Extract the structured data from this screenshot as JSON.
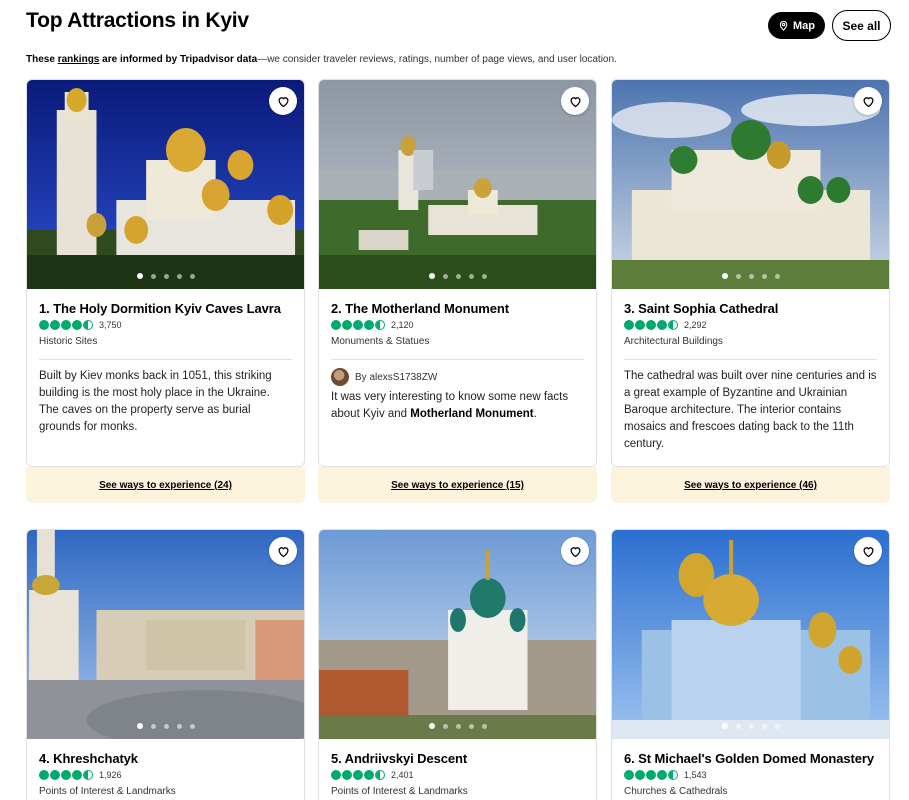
{
  "header": {
    "title": "Top Attractions in Kyiv",
    "map_label": "Map",
    "see_all_label": "See all"
  },
  "disclaimer": {
    "prefix": "These ",
    "link": "rankings",
    "middle": " are informed by Tripadvisor data",
    "suffix": "—we consider traveler reviews, ratings, number of page views, and user location."
  },
  "colors": {
    "rating_green": "#00aa6c",
    "experience_bg": "#fcf3dd"
  },
  "cards": [
    {
      "title": "1. The Holy Dormition Kyiv Caves Lavra",
      "rating": 4.5,
      "review_count": "3,750",
      "category": "Historic Sites",
      "description": "Built by Kiev monks back in 1051, this striking building is the most holy place in the Ukraine. The caves on the property serve as burial grounds for monks.",
      "experience_label": "See ways to experience (24)"
    },
    {
      "title": "2. The Motherland Monument",
      "rating": 4.5,
      "review_count": "2,120",
      "category": "Monuments & Statues",
      "review_author": "By alexsS1738ZW",
      "review_text_a": "It was very interesting to know some new facts about Kyiv and ",
      "review_text_bold": "Motherland Monument",
      "review_text_b": ".",
      "experience_label": "See ways to experience (15)"
    },
    {
      "title": "3. Saint Sophia Cathedral",
      "rating": 4.5,
      "review_count": "2,292",
      "category": "Architectural Buildings",
      "description": "The cathedral was built over nine centuries and is a great example of Byzantine and Ukrainian Baroque architecture. The interior contains mosaics and frescoes dating back to the 11th century.",
      "experience_label": "See ways to experience (46)"
    },
    {
      "title": "4. Khreshchatyk",
      "rating": 4.5,
      "review_count": "1,926",
      "category": "Points of Interest & Landmarks"
    },
    {
      "title": "5. Andriivskyi Descent",
      "rating": 4.5,
      "review_count": "2,401",
      "category": "Points of Interest & Landmarks"
    },
    {
      "title": "6. St Michael's Golden Domed Monastery",
      "rating": 4.5,
      "review_count": "1,543",
      "category": "Churches & Cathedrals"
    }
  ],
  "icons": {
    "map": "map-pin-icon",
    "save": "heart-icon",
    "rating": "rating-bubbles-icon"
  }
}
